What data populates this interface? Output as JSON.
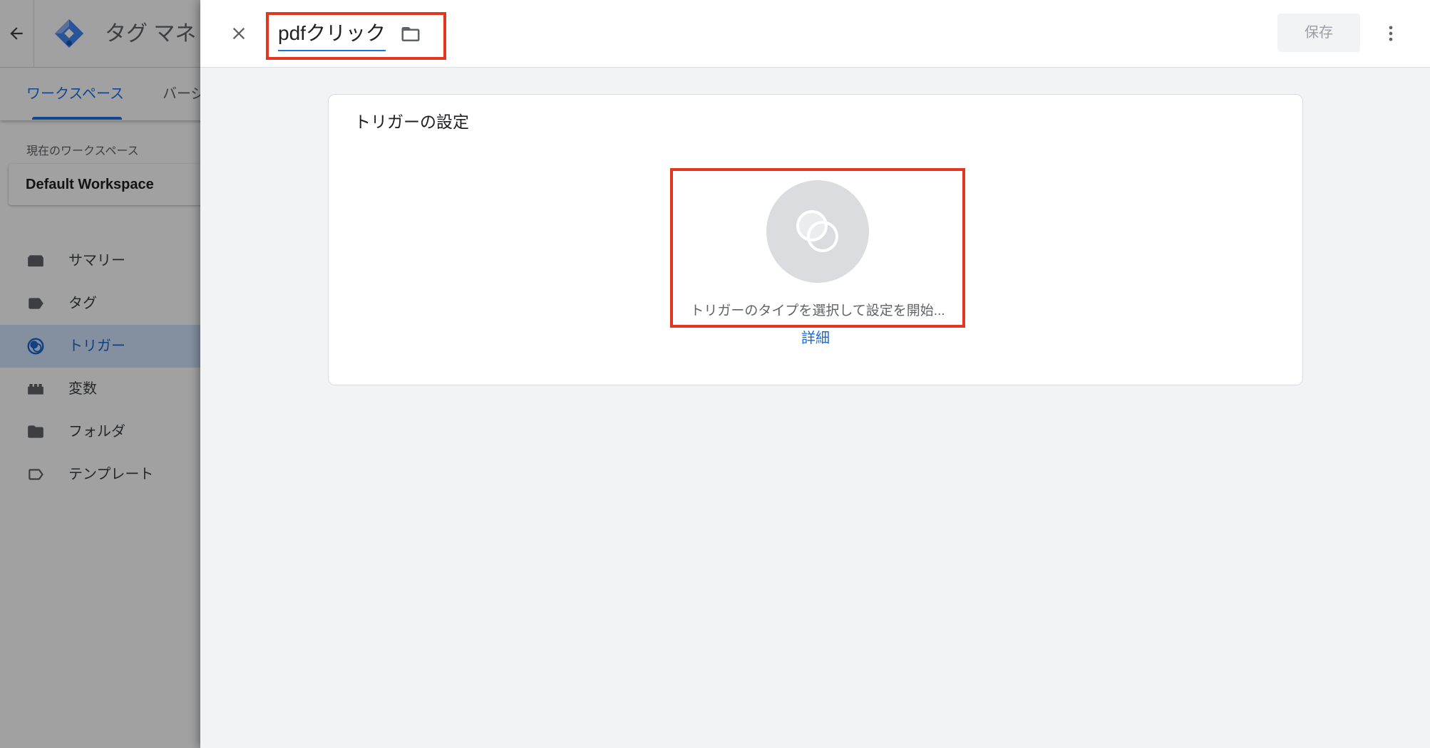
{
  "gtm": {
    "title": "タグ マネ",
    "tabs": [
      {
        "label": "ワークスペース",
        "active": true
      },
      {
        "label": "バージ",
        "active": false
      }
    ],
    "workspace_caption": "現在のワークスペース",
    "workspace_name": "Default Workspace",
    "nav": [
      {
        "label": "サマリー",
        "icon": "summary-icon",
        "selected": false
      },
      {
        "label": "タグ",
        "icon": "tag-icon",
        "selected": false
      },
      {
        "label": "トリガー",
        "icon": "trigger-icon",
        "selected": true
      },
      {
        "label": "変数",
        "icon": "variables-icon",
        "selected": false
      },
      {
        "label": "フォルダ",
        "icon": "folder-icon",
        "selected": false
      },
      {
        "label": "テンプレート",
        "icon": "template-icon",
        "selected": false
      }
    ]
  },
  "editor": {
    "trigger_name": "pdfクリック",
    "save_label": "保存",
    "save_enabled": false,
    "card_title": "トリガーの設定",
    "placeholder_text": "トリガーのタイプを選択して設定を開始...",
    "learn_more_label": "詳細"
  },
  "icons": {
    "back": "back-arrow-icon",
    "logo": "gtm-logo-icon",
    "close": "close-icon",
    "folder": "folder-outline-icon",
    "more": "more-vert-icon",
    "trigger_placeholder": "trigger-type-placeholder-icon"
  },
  "colors": {
    "accent": "#1a73e8",
    "link": "#1967d2",
    "selected_nav_bg": "#d2e3fc",
    "highlight_box": "#e4361e",
    "panel_bg": "#f1f3f4",
    "placeholder_circle": "#dadce0"
  }
}
